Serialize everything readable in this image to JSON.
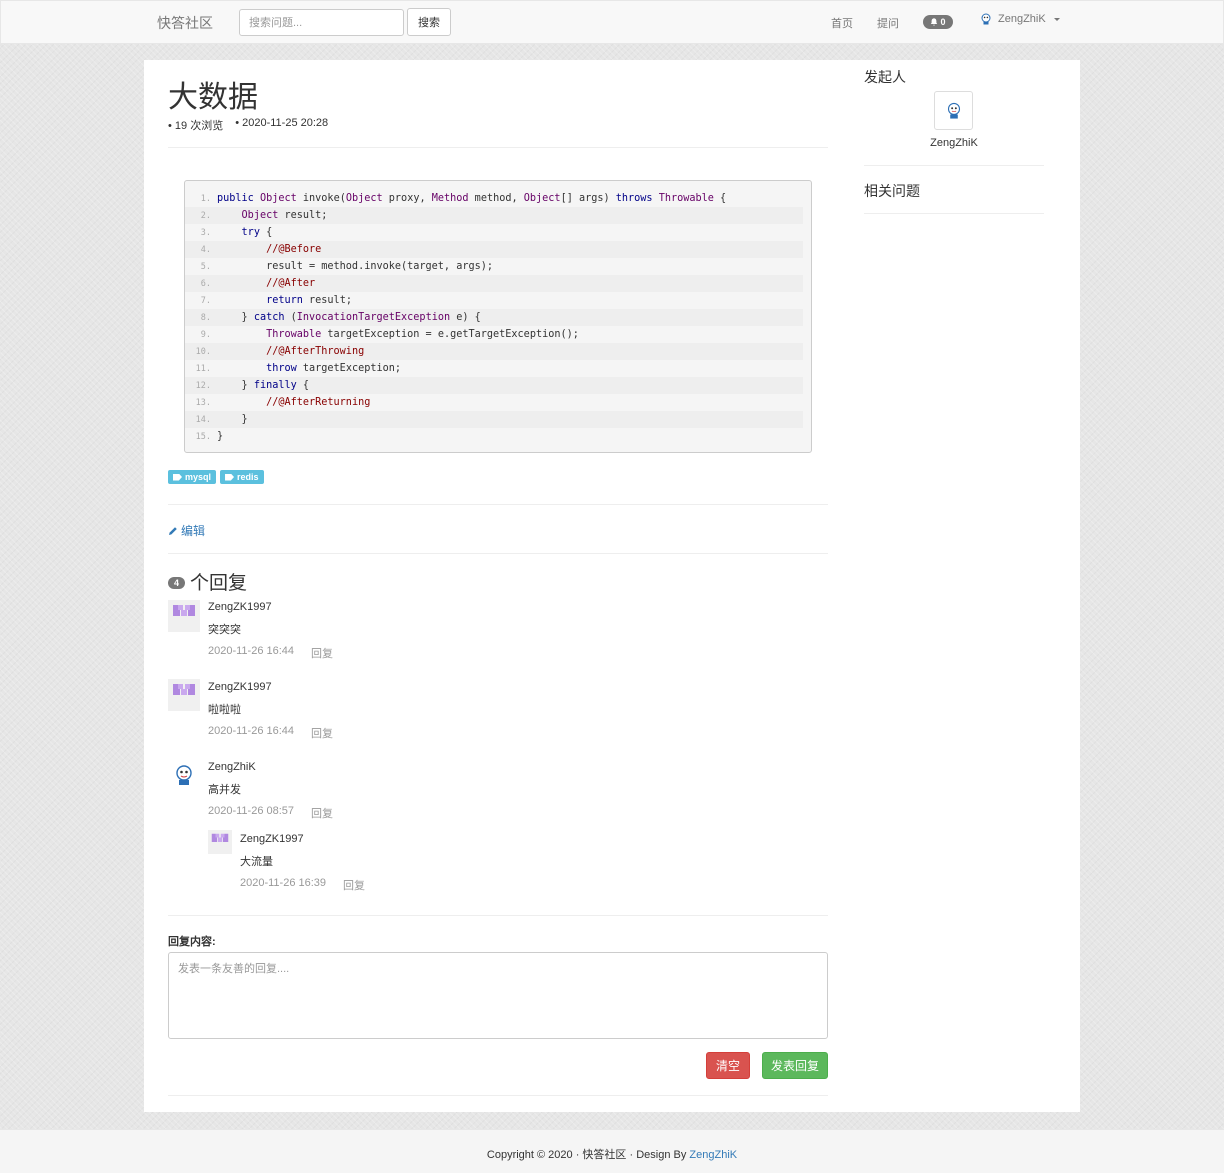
{
  "nav": {
    "brand": "快答社区",
    "search_placeholder": "搜索问题...",
    "search_button": "搜索",
    "home": "首页",
    "ask": "提问",
    "notification_count": "0",
    "username": "ZengZhiK"
  },
  "question": {
    "title": "大数据",
    "views": "• 19 次浏览",
    "date": "• 2020-11-25 20:28",
    "tags": [
      "mysql",
      "redis"
    ],
    "edit_label": "编辑"
  },
  "code": {
    "line_numbers": [
      "1.",
      "2.",
      "3.",
      "4.",
      "5.",
      "6.",
      "7.",
      "8.",
      "9.",
      "10.",
      "11.",
      "12.",
      "13.",
      "14.",
      "15."
    ],
    "lines": [
      "public Object invoke(Object proxy, Method method, Object[] args) throws Throwable {",
      "    Object result;",
      "    try {",
      "        //@Before",
      "        result = method.invoke(target, args);",
      "        //@After",
      "        return result;",
      "    } catch (InvocationTargetException e) {",
      "        Throwable targetException = e.getTargetException();",
      "        //@AfterThrowing",
      "        throw targetException;",
      "    } finally {",
      "        //@AfterReturning",
      "    }",
      "}"
    ]
  },
  "replies": {
    "count": "4",
    "count_label": "个回复",
    "items": [
      {
        "name": "ZengZK1997",
        "text": "突突突",
        "time": "2020-11-26 16:44",
        "reply": "回复"
      },
      {
        "name": "ZengZK1997",
        "text": "啦啦啦",
        "time": "2020-11-26 16:44",
        "reply": "回复"
      },
      {
        "name": "ZengZhiK",
        "text": "高并发",
        "time": "2020-11-26 08:57",
        "reply": "回复"
      },
      {
        "name": "ZengZK1997",
        "text": "大流量",
        "time": "2020-11-26 16:39",
        "reply": "回复"
      }
    ]
  },
  "reply_form": {
    "label": "回复内容:",
    "placeholder": "发表一条友善的回复....",
    "clear_button": "清空",
    "submit_button": "发表回复"
  },
  "sidebar": {
    "initiator_heading": "发起人",
    "initiator_name": "ZengZhiK",
    "related_heading": "相关问题"
  },
  "footer": {
    "text": "Copyright © 2020 · 快答社区 · Design By ",
    "author_link": "ZengZhiK"
  },
  "colors": {
    "tag": "#5bc0de",
    "link": "#337ab7",
    "danger": "#d9534f",
    "success": "#5cb85c"
  }
}
